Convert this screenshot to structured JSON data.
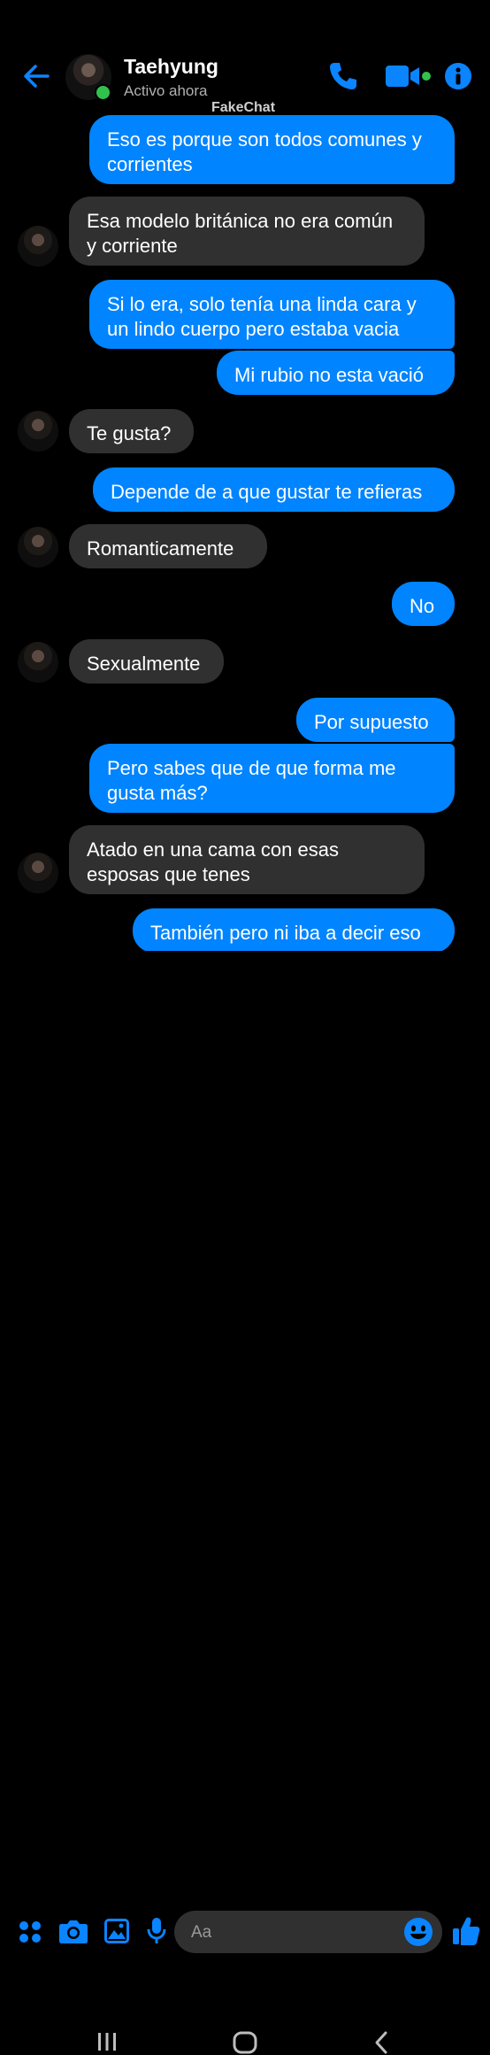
{
  "header": {
    "contact_name": "Taehyung",
    "status": "Activo ahora",
    "watermark": "FakeChat",
    "icons": [
      "back-arrow-icon",
      "phone-icon",
      "video-camera-icon",
      "info-icon"
    ]
  },
  "messages": [
    {
      "from": "me",
      "text": "Eso es porque son todos comunes y corrientes"
    },
    {
      "from": "them",
      "text": "Esa modelo británica no era común y corriente"
    },
    {
      "from": "me",
      "text": "Si lo era, solo tenía una linda cara y un lindo cuerpo pero estaba vacia"
    },
    {
      "from": "me",
      "text": "Mi rubio no esta vació"
    },
    {
      "from": "them",
      "text": "Te gusta?"
    },
    {
      "from": "me",
      "text": "Depende de a que gustar te refieras"
    },
    {
      "from": "them",
      "text": "Romanticamente"
    },
    {
      "from": "me",
      "text": "No"
    },
    {
      "from": "them",
      "text": "Sexualmente"
    },
    {
      "from": "me",
      "text": "Por supuesto"
    },
    {
      "from": "me",
      "text": "Pero sabes que de que forma me gusta más?"
    },
    {
      "from": "them",
      "text": "Atado en una cama con esas esposas que tenes"
    },
    {
      "from": "me",
      "text": "También pero ni iba a decir eso"
    }
  ],
  "composer": {
    "placeholder": "Aa",
    "icons": [
      "apps-grid-icon",
      "camera-icon",
      "image-icon",
      "microphone-icon",
      "emoji-icon",
      "thumbs-up-icon"
    ]
  },
  "navbar": {
    "icons": [
      "recent-apps-icon",
      "home-icon",
      "back-icon"
    ]
  },
  "colors": {
    "accent": "#0084ff",
    "incoming_bubble": "#303030",
    "background": "#000000",
    "online": "#31c24d"
  }
}
